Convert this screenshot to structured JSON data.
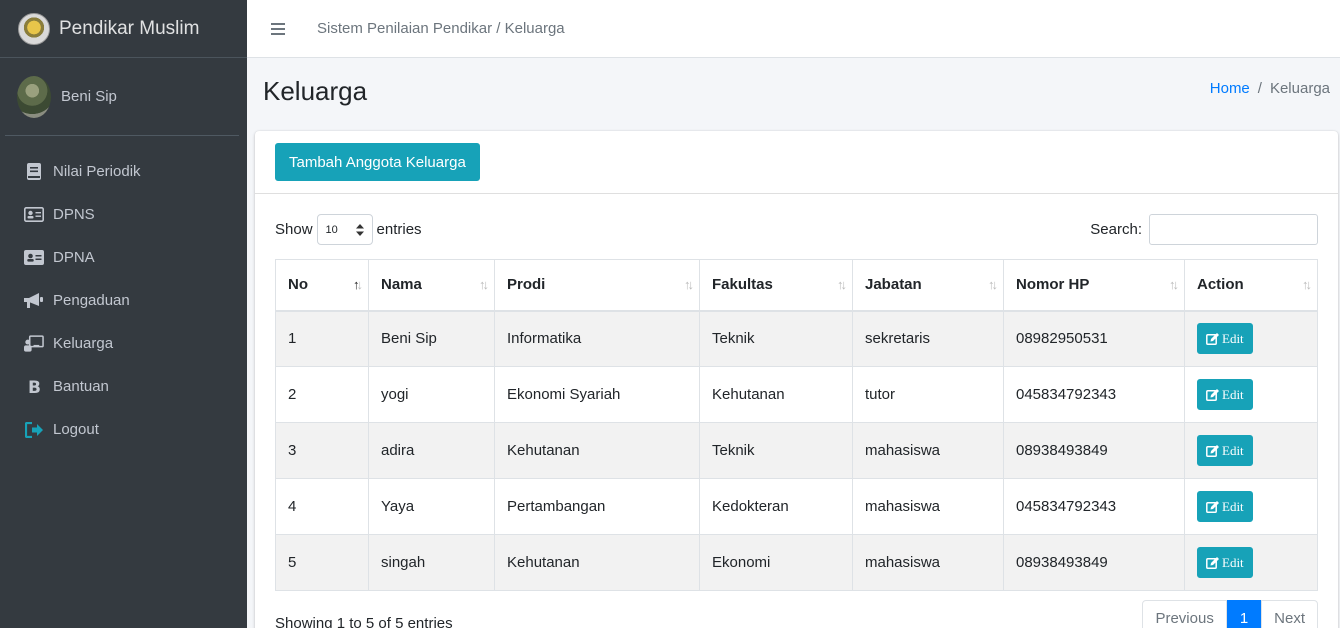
{
  "brand": {
    "name": "Pendikar Muslim"
  },
  "user": {
    "name": "Beni Sip"
  },
  "sidebar": {
    "items": [
      {
        "label": "Nilai Periodik",
        "icon": "book-icon"
      },
      {
        "label": "DPNS",
        "icon": "id-card-icon"
      },
      {
        "label": "DPNA",
        "icon": "address-card-icon"
      },
      {
        "label": "Pengaduan",
        "icon": "bullhorn-icon"
      },
      {
        "label": "Keluarga",
        "icon": "chalkboard-teacher-icon"
      },
      {
        "label": "Bantuan",
        "icon": "bold-b-icon"
      },
      {
        "label": "Logout",
        "icon": "sign-out-icon"
      }
    ]
  },
  "topbar": {
    "title": "Sistem Penilaian Pendikar / Keluarga"
  },
  "page": {
    "title": "Keluarga"
  },
  "breadcrumb": {
    "home": "Home",
    "separator": "/",
    "current": "Keluarga"
  },
  "card": {
    "add_button": "Tambah Anggota Keluarga"
  },
  "table_controls": {
    "show_label": "Show",
    "entries_value": "10",
    "entries_label": "entries",
    "search_label": "Search:",
    "search_value": ""
  },
  "table": {
    "headers": [
      "No",
      "Nama",
      "Prodi",
      "Fakultas",
      "Jabatan",
      "Nomor HP",
      "Action"
    ],
    "rows": [
      [
        "1",
        "Beni Sip",
        "Informatika",
        "Teknik",
        "sekretaris",
        "08982950531"
      ],
      [
        "2",
        "yogi",
        "Ekonomi Syariah",
        "Kehutanan",
        "tutor",
        "045834792343"
      ],
      [
        "3",
        "adira",
        "Kehutanan",
        "Teknik",
        "mahasiswa",
        "08938493849"
      ],
      [
        "4",
        "Yaya",
        "Pertambangan",
        "Kedokteran",
        "mahasiswa",
        "045834792343"
      ],
      [
        "5",
        "singah",
        "Kehutanan",
        "Ekonomi",
        "mahasiswa",
        "08938493849"
      ]
    ],
    "edit_label": "Edit"
  },
  "footer": {
    "info": "Showing 1 to 5 of 5 entries",
    "previous": "Previous",
    "current_page": "1",
    "next": "Next"
  },
  "colors": {
    "sidebar": "#343a40",
    "accent": "#17a2b8",
    "primary": "#007bff"
  }
}
